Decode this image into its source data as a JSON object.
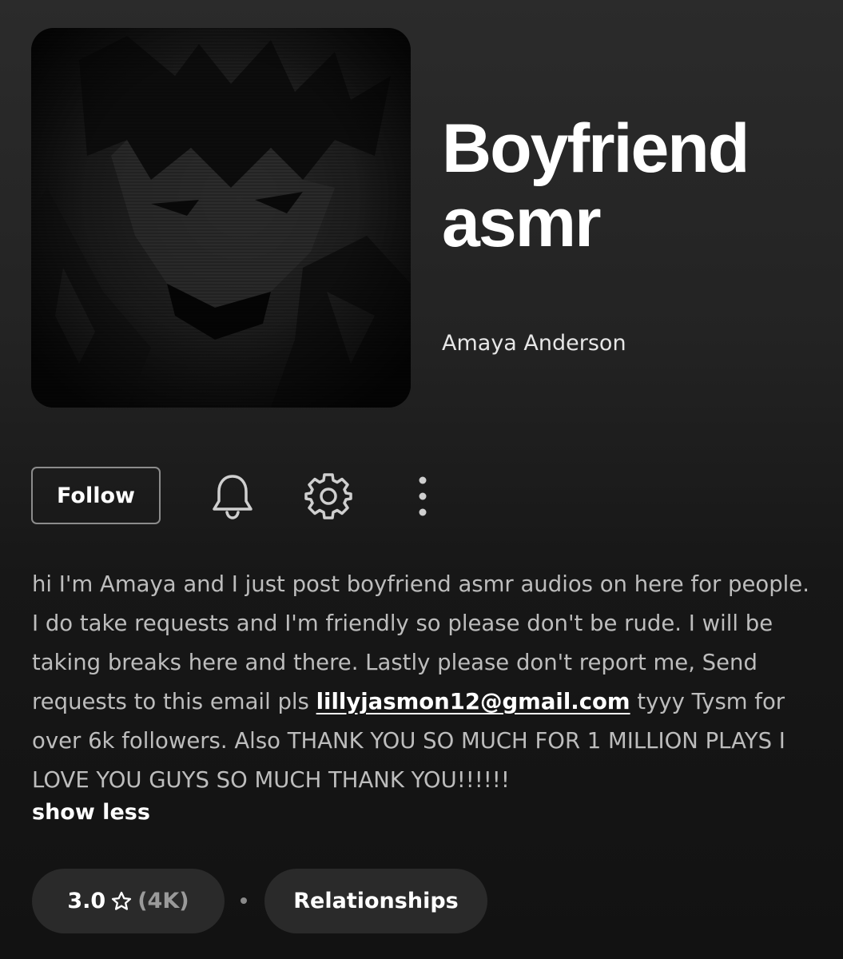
{
  "podcast": {
    "title": "Boyfriend asmr",
    "author": "Amaya Anderson"
  },
  "actions": {
    "follow_label": "Follow",
    "icons": [
      "bell-icon",
      "gear-icon",
      "more-vertical-icon"
    ]
  },
  "description": {
    "text_before_email": "hi I'm Amaya and I just post boyfriend asmr audios on here for people. I do take requests and I'm friendly so please don't be rude. I will be taking breaks here and there. Lastly please don't report me, Send requests to this email pls ",
    "email": "lillyjasmon12@gmail.com",
    "text_after_email": " tyyy Tysm for over 6k followers. Also THANK YOU SO MUCH FOR 1 MILLION PLAYS I LOVE YOU GUYS SO MUCH THANK YOU!!!!!!",
    "toggle_label": "show less"
  },
  "rating": {
    "value": "3.0",
    "count": "(4K)",
    "icon": "star-outline-icon"
  },
  "category": {
    "label": "Relationships"
  },
  "colors": {
    "background_top": "#2b2b2b",
    "background_bottom": "#121212",
    "pill_background": "#2a2a2a",
    "description_text": "#bdbdbd"
  }
}
